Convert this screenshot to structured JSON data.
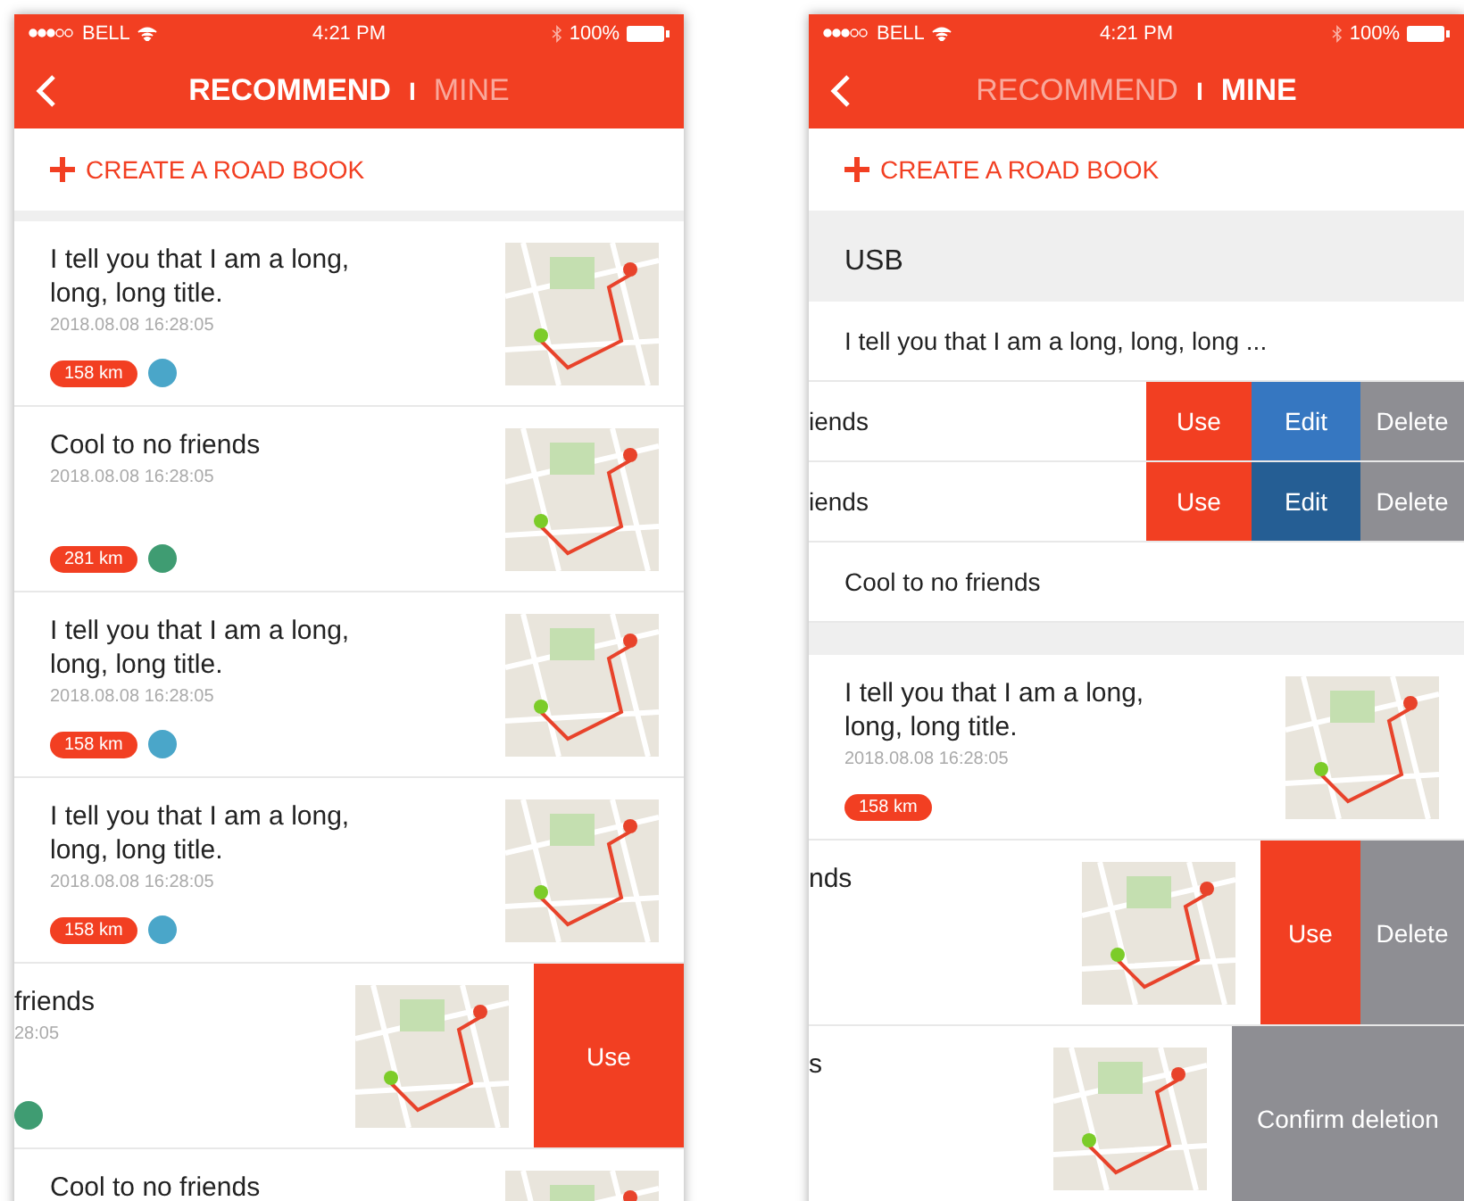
{
  "phones": [
    {
      "status_bar": {
        "carrier": "BELL",
        "time": "4:21 PM",
        "battery": "100%"
      },
      "tabs": [
        {
          "label": "RECOMMEND",
          "selected": true
        },
        {
          "label": "MINE",
          "selected": false
        }
      ],
      "tab_separator": "I",
      "create_button": "CREATE A ROAD BOOK",
      "items": [
        {
          "kind": "card",
          "title": "I tell you that I am a long, long, long title.",
          "date": "2018.08.08  16:28:05",
          "distance": "158 km",
          "color": "#4aa6c9"
        },
        {
          "kind": "card",
          "title": "Cool to no friends",
          "date": "2018.08.08  16:28:05",
          "distance": "281 km",
          "color": "#3f9c72"
        },
        {
          "kind": "card",
          "title": "I tell you that I am a long, long, long title.",
          "date": "2018.08.08  16:28:05",
          "distance": "158 km",
          "color": "#4aa6c9"
        },
        {
          "kind": "card",
          "title": "I tell you that I am a long, long, long title.",
          "date": "2018.08.08  16:28:05",
          "distance": "158 km",
          "color": "#4aa6c9"
        },
        {
          "kind": "card",
          "title": "friends",
          "date": "28:05",
          "color": "#3f9c72",
          "actions": [
            {
              "kind": "use",
              "label": "Use",
              "pressed": false
            }
          ]
        },
        {
          "kind": "card",
          "title": "Cool to no friends"
        }
      ]
    },
    {
      "status_bar": {
        "carrier": "BELL",
        "time": "4:21 PM",
        "battery": "100%"
      },
      "tabs": [
        {
          "label": "RECOMMEND",
          "selected": false
        },
        {
          "label": "MINE",
          "selected": true
        }
      ],
      "tab_separator": "I",
      "create_button": "CREATE A ROAD BOOK",
      "items": [
        {
          "kind": "section",
          "title": "USB"
        },
        {
          "kind": "row",
          "title": "I tell you that I am a long, long, long ..."
        },
        {
          "kind": "row",
          "title": "iends",
          "actions": [
            {
              "kind": "use",
              "label": "Use",
              "pressed": false
            },
            {
              "kind": "edit",
              "label": "Edit",
              "pressed": false
            },
            {
              "kind": "delete",
              "label": "Delete",
              "pressed": false
            }
          ]
        },
        {
          "kind": "row",
          "title": "iends",
          "actions": [
            {
              "kind": "use",
              "label": "Use",
              "pressed": false
            },
            {
              "kind": "edit",
              "label": "Edit",
              "pressed": true
            },
            {
              "kind": "delete",
              "label": "Delete",
              "pressed": false
            }
          ]
        },
        {
          "kind": "row",
          "title": "Cool to no friends"
        },
        {
          "kind": "spacer"
        },
        {
          "kind": "card",
          "title": "I tell you that I am a long, long, long title.",
          "date": "2018.08.08  16:28:05",
          "distance": "158 km"
        },
        {
          "kind": "card",
          "title": "nds",
          "actions": [
            {
              "kind": "use",
              "label": "Use",
              "pressed": false
            },
            {
              "kind": "delete",
              "label": "Delete",
              "pressed": false
            }
          ]
        },
        {
          "kind": "card",
          "title": "s",
          "actions": [
            {
              "kind": "confirm",
              "label": "Confirm deletion",
              "pressed": false
            }
          ]
        }
      ]
    }
  ]
}
